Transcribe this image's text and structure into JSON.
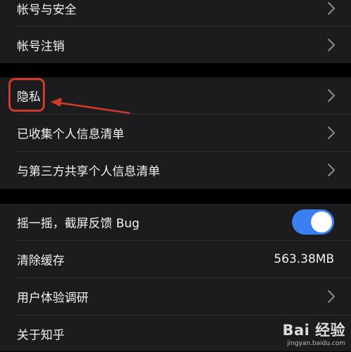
{
  "settings": {
    "group1": [
      {
        "label": "帐号与安全",
        "chevron": true
      },
      {
        "label": "帐号注销",
        "chevron": true
      }
    ],
    "group2": [
      {
        "label": "隐私",
        "chevron": true
      },
      {
        "label": "已收集个人信息清单",
        "chevron": true
      },
      {
        "label": "与第三方共享个人信息清单",
        "chevron": true
      }
    ],
    "group3": {
      "shake_feedback": {
        "label": "摇一摇，截屏反馈 Bug",
        "toggle_on": true
      },
      "clear_cache": {
        "label": "清除缓存",
        "value": "563.38MB"
      },
      "ux_research": {
        "label": "用户体验调研",
        "chevron": true
      },
      "about": {
        "label": "关于知乎"
      }
    }
  },
  "annotation": {
    "highlight_color": "#d13a2a"
  },
  "watermark": {
    "brand": "Bai 经验",
    "url": "jingyan.baidu.com"
  },
  "colors": {
    "background": "#000000",
    "cell": "#1c1c1e",
    "toggle_on": "#3c7ff0"
  }
}
